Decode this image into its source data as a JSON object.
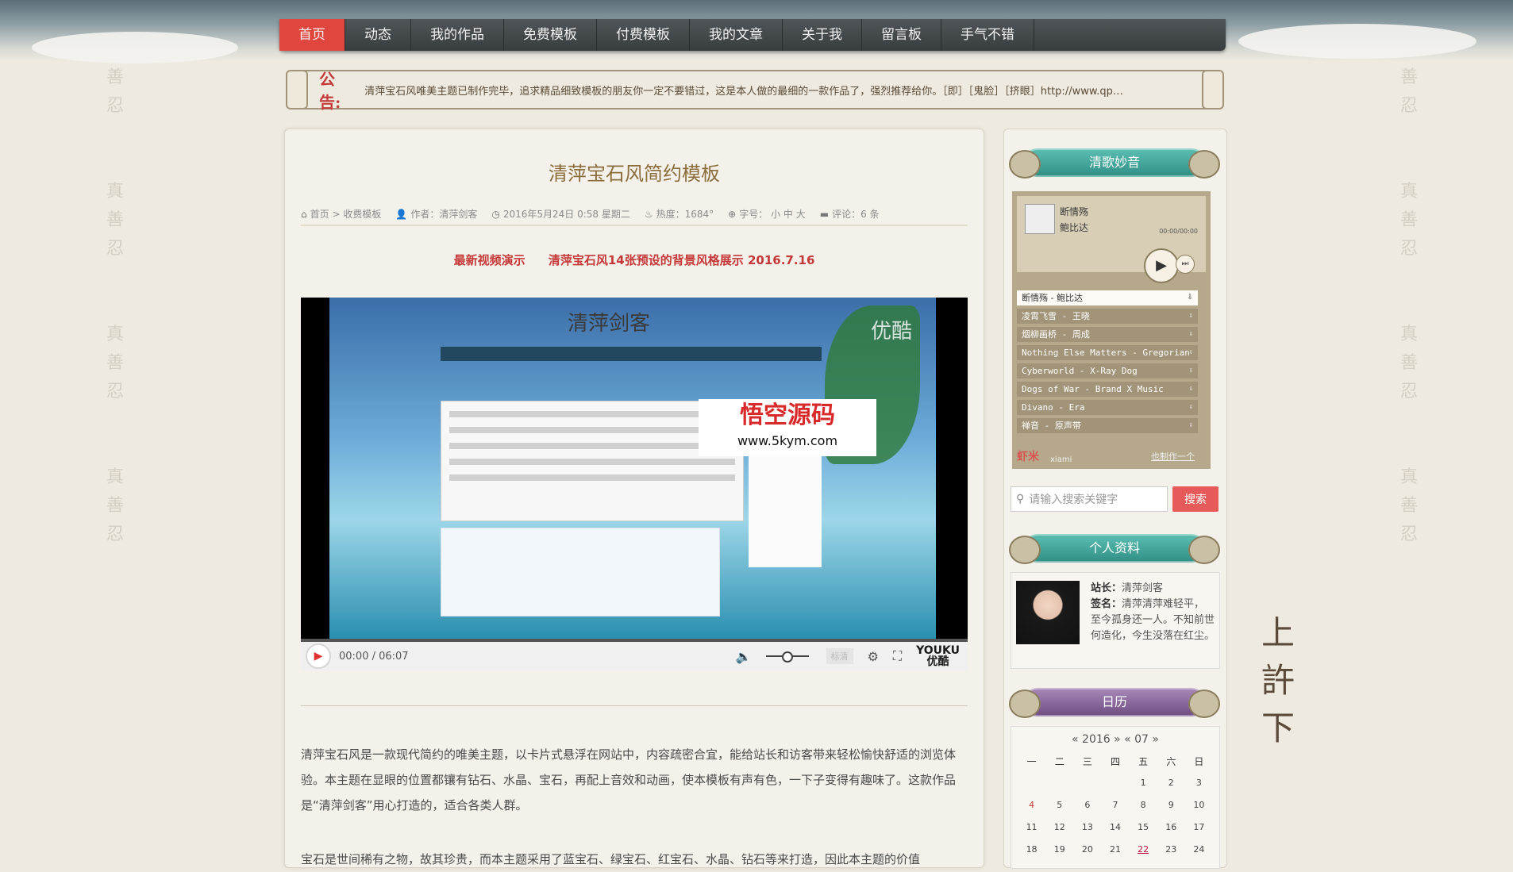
{
  "nav": {
    "items": [
      "首页",
      "动态",
      "我的作品",
      "免费模板",
      "付费模板",
      "我的文章",
      "关于我",
      "留言板",
      "手气不错"
    ]
  },
  "notice": {
    "label": "公告:",
    "text": "清萍宝石风唯美主题已制作完毕，追求精品细致模板的朋友你一定不要错过，这是本人做的最细的一款作品了，强烈推荐给你。［即］［鬼脸］［挤眼］http://www.qp…"
  },
  "post": {
    "title": "清萍宝石风简约模板",
    "meta": {
      "breadcrumb_home": "首页",
      "breadcrumb_sep": ">",
      "category": "收费模板",
      "author": "作者：清萍剑客",
      "date": "2016年5月24日 0:58 星期二",
      "hot": "热度：1684°",
      "fontsize_label": "字号：",
      "fontsize_small": "小",
      "fontsize_mid": "中",
      "fontsize_big": "大",
      "comments": "评论：6 条"
    },
    "headline_left": "最新视频演示",
    "headline_right": "清萍宝石风14张预设的背景风格展示 2016.7.16",
    "video": {
      "inner_title": "清萍剑客",
      "youku_mark": "优酷",
      "watermark_cn": "悟空源码",
      "watermark_url": "www.5kym.com",
      "time": "00:00 / 06:07",
      "quality": "标清",
      "youku_logo_top": "YOUKU",
      "youku_logo_bottom": "优酷"
    },
    "para1": "清萍宝石风是一款现代简约的唯美主题，以卡片式悬浮在网站中，内容疏密合宜，能给站长和访客带来轻松愉快舒适的浏览体验。本主题在显眼的位置都镶有钻石、水晶、宝石，再配上音效和动画，使本模板有声有色，一下子变得有趣味了。这款作品是“清萍剑客”用心打造的，适合各类人群。",
    "para2": "宝石是世间稀有之物，故其珍贵，而本主题采用了蓝宝石、绿宝石、红宝石、水晶、钻石等来打造，因此本主题的价值"
  },
  "sidebar": {
    "music_title": "清歌妙音",
    "now_playing_song": "断情殇",
    "now_playing_artist": "鲍比达",
    "player_time": "00:00/00:00",
    "playlist": [
      "断情殇 - 鲍比达",
      "凌霄飞雪 - 王晓",
      "烟柳画桥 - 周成",
      "Nothing Else Matters - Gregorian",
      "Cyberworld - X-Ray Dog",
      "Dogs of War - Brand X Music",
      "Divano - Era",
      "禅音 - 原声带"
    ],
    "brand": "虾米",
    "brand_sub": "xiami",
    "brand_link": "也制作一个",
    "search_placeholder": "请输入搜索关键字",
    "search_button": "搜索",
    "profile_title": "个人资料",
    "profile_owner_label": "站长：",
    "profile_owner": "清萍剑客",
    "profile_sign_label": "签名：",
    "profile_sign": "清萍清萍难轻平，至今孤身还一人。不知前世何造化，今生没落在红尘。",
    "calendar_title": "日历",
    "calendar_caption": "« 2016 » « 07 »",
    "calendar_weekdays": [
      "一",
      "二",
      "三",
      "四",
      "五",
      "六",
      "日"
    ],
    "calendar_rows": [
      [
        "",
        "",
        "",
        "",
        "1",
        "2",
        "3"
      ],
      [
        "4",
        "5",
        "6",
        "7",
        "8",
        "9",
        "10"
      ],
      [
        "11",
        "12",
        "13",
        "14",
        "15",
        "16",
        "17"
      ],
      [
        "18",
        "19",
        "20",
        "21",
        "22",
        "23",
        "24"
      ]
    ]
  },
  "side_calligraphy": [
    "上",
    "許",
    "下"
  ],
  "colors": {
    "nav_active": "#e0463d",
    "accent_red": "#c43838",
    "title_gold": "#8a6d3b"
  }
}
